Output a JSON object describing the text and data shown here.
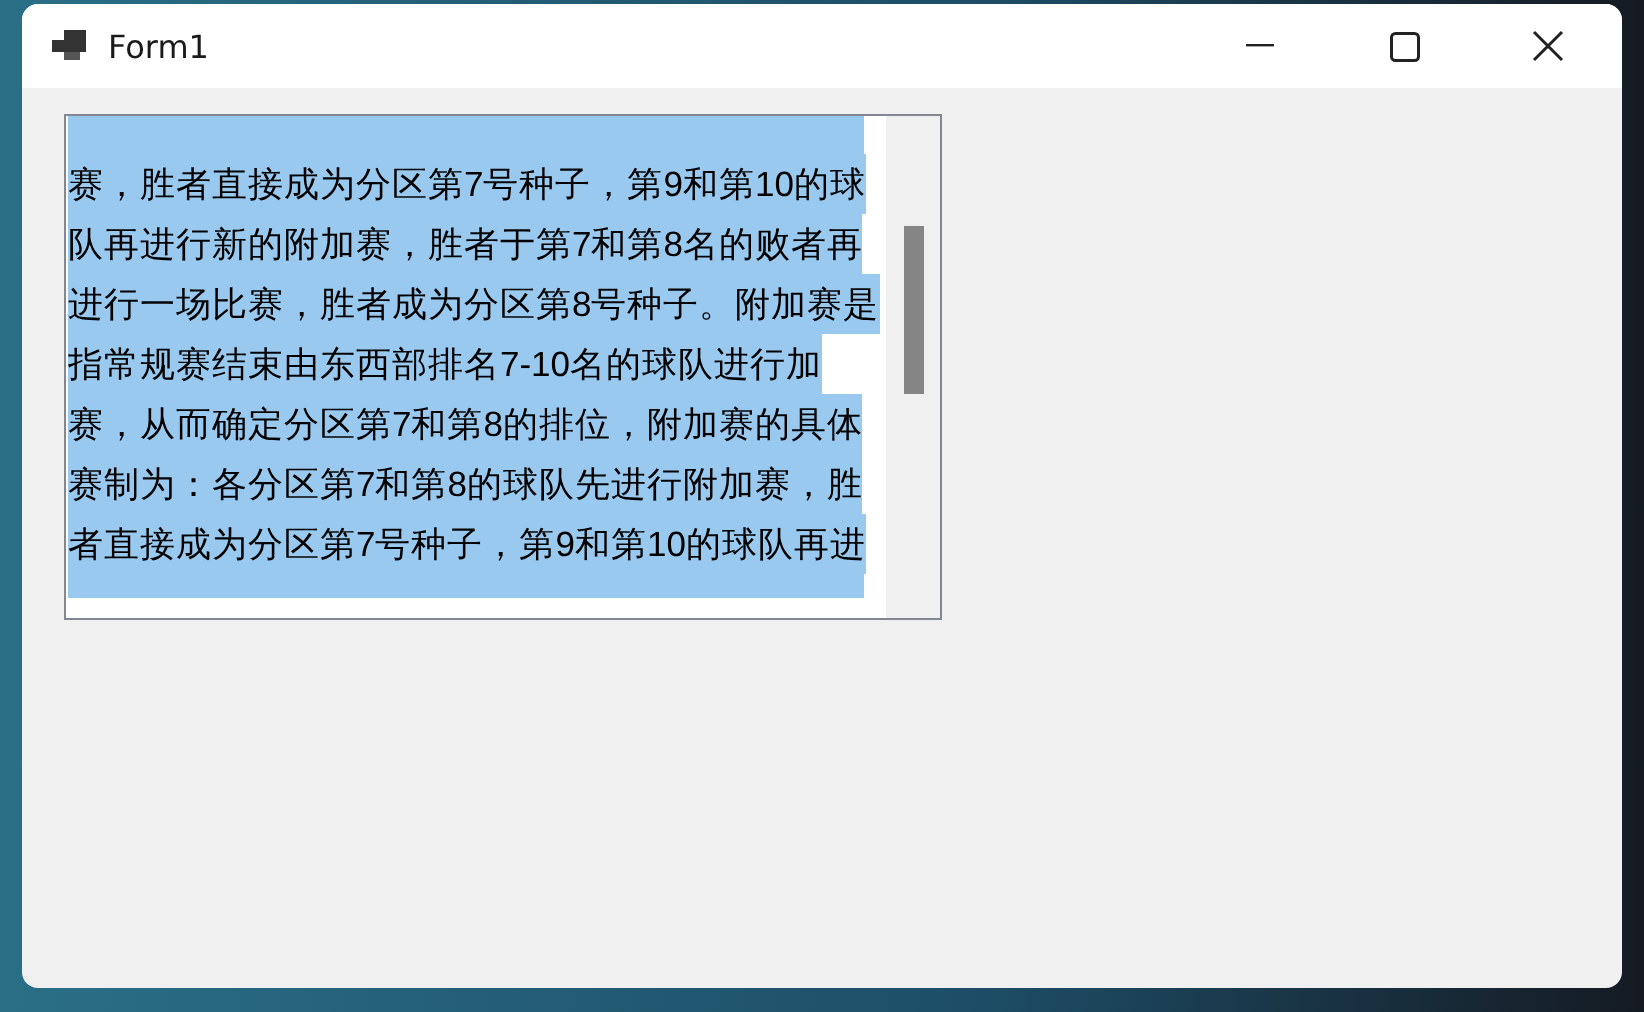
{
  "window": {
    "title": "Form1"
  },
  "textbox": {
    "lines": [
      {
        "text": "赛，胜者直接成为分区第7号种子，第9和第10的球",
        "selected": true
      },
      {
        "text": "队再进行新的附加赛，胜者于第7和第8名的败者再",
        "selected": true
      },
      {
        "text": "进行一场比赛，胜者成为分区第8号种子。附加赛是",
        "selected": true
      },
      {
        "text": "指常规赛结束由东西部排名7-10名的球队进行加",
        "selected": true
      },
      {
        "text": "赛，从而确定分区第7和第8的排位，附加赛的具体",
        "selected": true
      },
      {
        "text": "赛制为：各分区第7和第8的球队先进行附加赛，胜",
        "selected": true
      },
      {
        "text": "者直接成为分区第7号种子，第9和第10的球队再进",
        "selected": true
      }
    ]
  }
}
